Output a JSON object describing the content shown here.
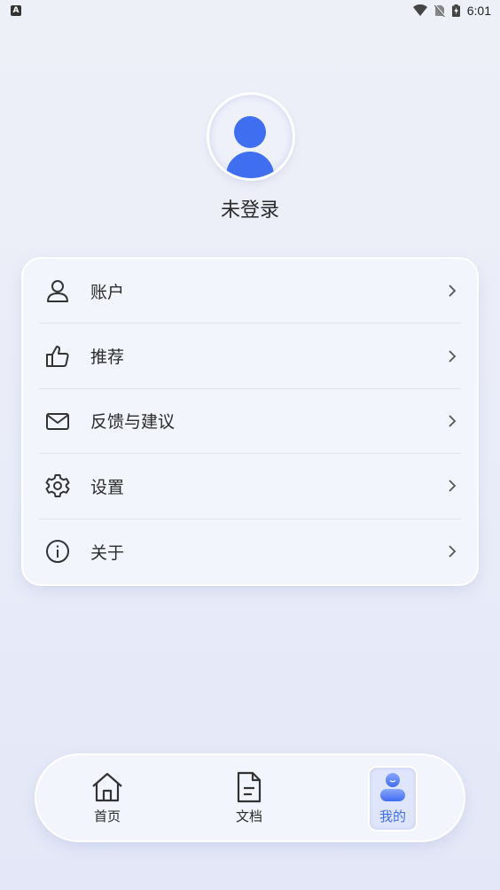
{
  "status_bar": {
    "time": "6:01",
    "notification_icon": "A"
  },
  "profile": {
    "username": "未登录"
  },
  "menu": {
    "items": [
      {
        "label": "账户",
        "icon": "user-icon"
      },
      {
        "label": "推荐",
        "icon": "thumbs-up-icon"
      },
      {
        "label": "反馈与建议",
        "icon": "mail-icon"
      },
      {
        "label": "设置",
        "icon": "gear-icon"
      },
      {
        "label": "关于",
        "icon": "info-icon"
      }
    ]
  },
  "bottom_nav": {
    "items": [
      {
        "label": "首页",
        "icon": "home-icon",
        "active": false
      },
      {
        "label": "文档",
        "icon": "document-icon",
        "active": false
      },
      {
        "label": "我的",
        "icon": "profile-icon",
        "active": true
      }
    ],
    "active_color": "#3f6ef0"
  },
  "colors": {
    "accent": "#3f6ef0",
    "background": "#eef0f8"
  }
}
